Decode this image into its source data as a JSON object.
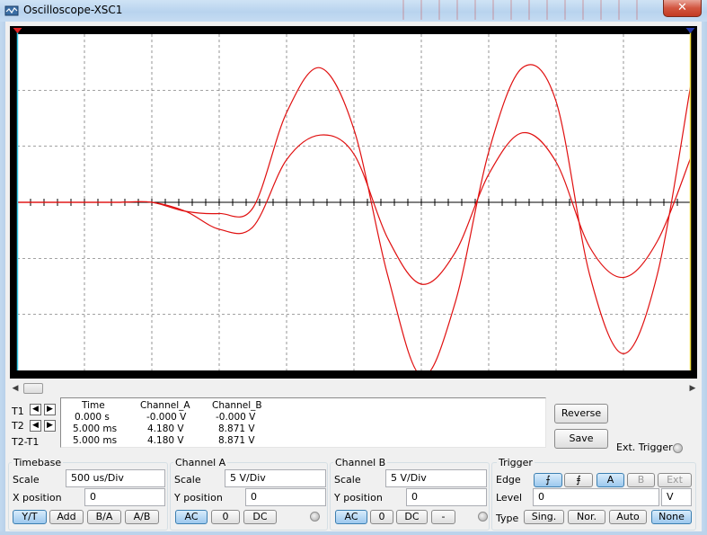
{
  "window": {
    "title": "Oscilloscope-XSC1",
    "close_glyph": "✕"
  },
  "scrollbar": {
    "left_arrow": "◀",
    "right_arrow": "▶"
  },
  "cursors": {
    "t1_label": "T1",
    "t2_label": "T2",
    "t2t1_label": "T2-T1",
    "left_arrow": "◀",
    "right_arrow": "▶"
  },
  "readout": {
    "headers": {
      "time": "Time",
      "a": "Channel_A",
      "b": "Channel_B"
    },
    "rows": [
      {
        "time": "0.000 s",
        "a": "-0.000 V",
        "b": "-0.000 V"
      },
      {
        "time": "5.000 ms",
        "a": "4.180 V",
        "b": "8.871 V"
      },
      {
        "time": "5.000 ms",
        "a": "4.180 V",
        "b": "8.871 V"
      }
    ]
  },
  "side_buttons": {
    "reverse": "Reverse",
    "save": "Save",
    "ext_trigger": "Ext. Trigger"
  },
  "timebase": {
    "title": "Timebase",
    "scale_label": "Scale",
    "scale_value": "500 us/Div",
    "xpos_label": "X position",
    "xpos_value": "0",
    "modes": [
      "Y/T",
      "Add",
      "B/A",
      "A/B"
    ],
    "active_mode": "Y/T"
  },
  "channel_a": {
    "title": "Channel A",
    "scale_label": "Scale",
    "scale_value": "5  V/Div",
    "ypos_label": "Y position",
    "ypos_value": "0",
    "couplings": [
      "AC",
      "0",
      "DC"
    ],
    "active_coupling": "AC"
  },
  "channel_b": {
    "title": "Channel B",
    "scale_label": "Scale",
    "scale_value": "5  V/Div",
    "ypos_label": "Y position",
    "ypos_value": "0",
    "couplings": [
      "AC",
      "0",
      "DC",
      "-"
    ],
    "active_coupling": "AC"
  },
  "trigger": {
    "title": "Trigger",
    "edge_label": "Edge",
    "edge_rising": "⨍",
    "edge_falling": "⨎",
    "sources": [
      "A",
      "B",
      "Ext"
    ],
    "active_source": "A",
    "level_label": "Level",
    "level_value": "0",
    "level_unit": "V",
    "type_label": "Type",
    "types": [
      "Sing.",
      "Nor.",
      "Auto",
      "None"
    ],
    "active_type": "None"
  },
  "colors": {
    "trace": "#e01010",
    "grid": "#6a6a6a",
    "cursor1": "#32c8e6",
    "cursor2": "#f0dc3c",
    "background": "#000000"
  },
  "chart_data": {
    "type": "line",
    "x_divisions": 10,
    "y_divisions": 6,
    "x_units_per_div": "500 us",
    "y_units_per_div": "5 V",
    "x": [
      0,
      0.25,
      0.5,
      0.75,
      1.0,
      1.25,
      1.5,
      1.75,
      2.0,
      2.25,
      2.5,
      2.75,
      3.0,
      3.25,
      3.5,
      3.75,
      4.0,
      4.25,
      4.5,
      4.75,
      5.0
    ],
    "xlabel_unit": "ms",
    "ylabel_unit": "V",
    "ylim": [
      -15,
      15
    ],
    "xlim": [
      0,
      5
    ],
    "series": [
      {
        "values": [
          0,
          0,
          0,
          0,
          0,
          -0.8,
          -2.4,
          -2.2,
          3.8,
          6.0,
          4.3,
          -3.2,
          -7.3,
          -4.5,
          2.5,
          6.2,
          3.6,
          -4.0,
          -6.7,
          -3.5,
          4.0
        ]
      },
      {
        "values": [
          0,
          0,
          0,
          0,
          0,
          -0.8,
          -1.0,
          -0.5,
          8.0,
          12.0,
          6.5,
          -6.5,
          -15.5,
          -9.0,
          4.5,
          12.0,
          9.0,
          -6.5,
          -13.5,
          -6.5,
          10.5
        ]
      }
    ],
    "cursor_t1": 0,
    "cursor_t2": 5.0
  }
}
